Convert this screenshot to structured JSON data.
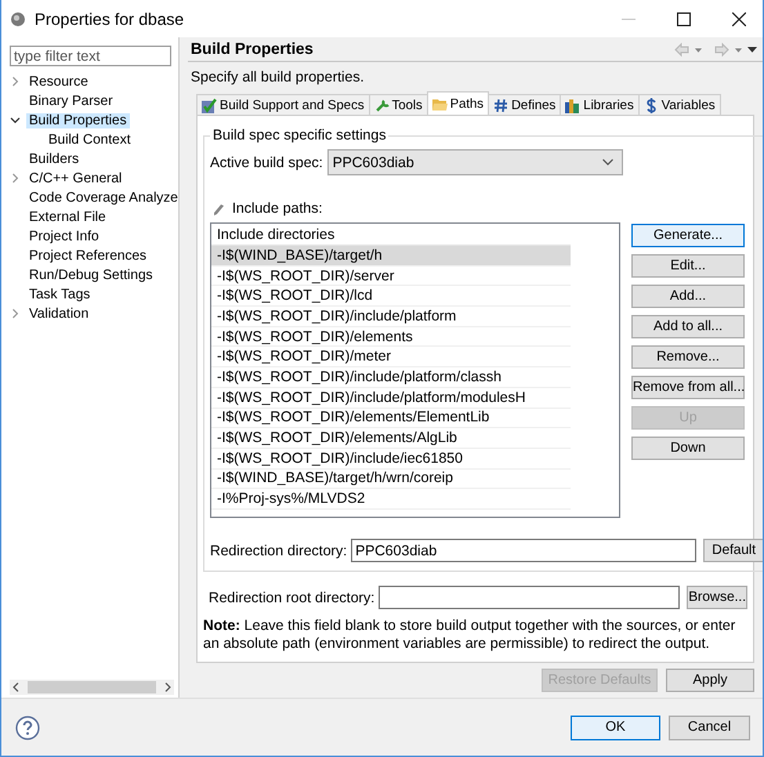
{
  "window": {
    "title": "Properties for dbase"
  },
  "sidebar": {
    "filter": {
      "placeholder": "type filter text"
    },
    "items": [
      {
        "label": "Resource",
        "expanded": false,
        "selected": false
      },
      {
        "label": "Binary Parser",
        "selected": false
      },
      {
        "label": "Build Properties",
        "expanded": true,
        "selected": true,
        "children": [
          {
            "label": "Build Context",
            "selected": false
          }
        ]
      },
      {
        "label": "Builders",
        "selected": false
      },
      {
        "label": "C/C++ General",
        "expanded": false,
        "selected": false
      },
      {
        "label": "Code Coverage Analyze",
        "selected": false
      },
      {
        "label": "External File",
        "selected": false
      },
      {
        "label": "Project Info",
        "selected": false
      },
      {
        "label": "Project References",
        "selected": false
      },
      {
        "label": "Run/Debug Settings",
        "selected": false
      },
      {
        "label": "Task Tags",
        "selected": false
      },
      {
        "label": "Validation",
        "expanded": false,
        "selected": false
      }
    ]
  },
  "page": {
    "title": "Build Properties",
    "description": "Specify all build properties.",
    "tabs": [
      {
        "label": "Build Support and Specs",
        "selected": false
      },
      {
        "label": "Tools",
        "selected": false
      },
      {
        "label": "Paths",
        "selected": true
      },
      {
        "label": "Defines",
        "selected": false
      },
      {
        "label": "Libraries",
        "selected": false
      },
      {
        "label": "Variables",
        "selected": false
      }
    ],
    "group": {
      "title": "Build spec specific settings",
      "active_spec_label": "Active build spec:",
      "active_spec": "PPC603diab",
      "include_label": "Include paths:",
      "table": {
        "column": "Include directories",
        "rows": [
          {
            "path": "-I$(WIND_BASE)/target/h",
            "selected": true
          },
          {
            "path": "-I$(WS_ROOT_DIR)/server",
            "selected": false
          },
          {
            "path": "-I$(WS_ROOT_DIR)/lcd",
            "selected": false
          },
          {
            "path": "-I$(WS_ROOT_DIR)/include/platform",
            "selected": false
          },
          {
            "path": "-I$(WS_ROOT_DIR)/elements",
            "selected": false
          },
          {
            "path": "-I$(WS_ROOT_DIR)/meter",
            "selected": false
          },
          {
            "path": "-I$(WS_ROOT_DIR)/include/platform/classh",
            "selected": false
          },
          {
            "path": "-I$(WS_ROOT_DIR)/include/platform/modulesH",
            "selected": false
          },
          {
            "path": "-I$(WS_ROOT_DIR)/elements/ElementLib",
            "selected": false
          },
          {
            "path": "-I$(WS_ROOT_DIR)/elements/AlgLib",
            "selected": false
          },
          {
            "path": "-I$(WS_ROOT_DIR)/include/iec61850",
            "selected": false
          },
          {
            "path": "-I$(WIND_BASE)/target/h/wrn/coreip",
            "selected": false
          },
          {
            "path": "-I%Proj-sys%/MLVDS2",
            "selected": false
          }
        ]
      },
      "buttons": [
        {
          "label": "Generate...",
          "disabled": false,
          "focused": true
        },
        {
          "label": "Edit...",
          "disabled": false,
          "focused": false
        },
        {
          "label": "Add...",
          "disabled": false,
          "focused": false
        },
        {
          "label": "Add to all...",
          "disabled": false,
          "focused": false
        },
        {
          "label": "Remove...",
          "disabled": false,
          "focused": false
        },
        {
          "label": "Remove from all...",
          "disabled": false,
          "focused": false
        },
        {
          "label": "Up",
          "disabled": true,
          "focused": false
        },
        {
          "label": "Down",
          "disabled": false,
          "focused": false
        }
      ],
      "redirection_label": "Redirection directory:",
      "redirection_value": "PPC603diab",
      "default_button": "Default"
    },
    "root_label": "Redirection root directory:",
    "browse_button": "Browse...",
    "note": "**Note:** Leave this field blank to store build output together with the sources, or enter an absolute path (environment variables are permissible) to redirect the output.",
    "restore_button": {
      "label": "Restore Defaults",
      "disabled": true
    },
    "apply_button": {
      "label": "Apply",
      "disabled": false
    }
  },
  "footer": {
    "buttons": [
      {
        "label": "OK",
        "focused": true
      },
      {
        "label": "Cancel",
        "focused": false
      }
    ]
  }
}
